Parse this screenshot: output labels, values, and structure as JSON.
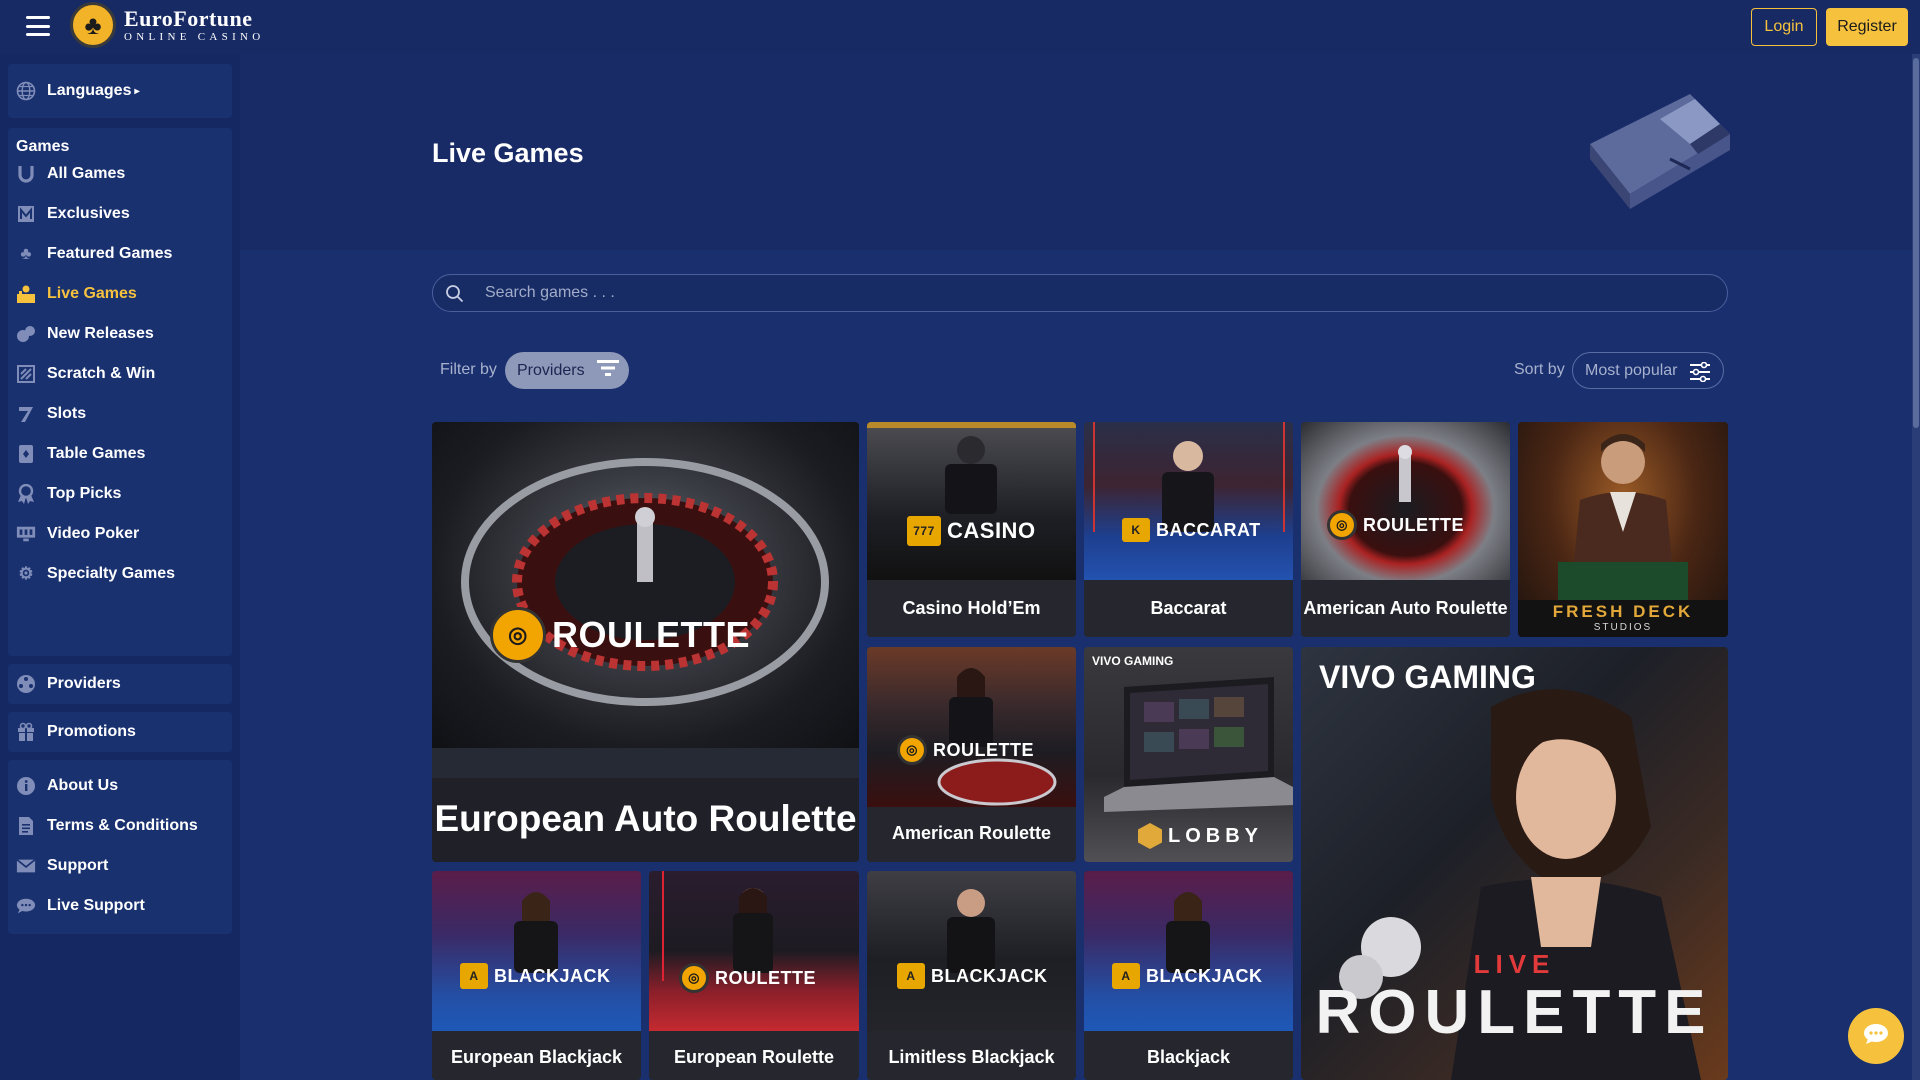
{
  "header": {
    "logo_main": "EuroFortune",
    "logo_sub": "ONLINE CASINO",
    "login_label": "Login",
    "register_label": "Register"
  },
  "sidebar": {
    "languages_label": "Languages",
    "games_heading": "Games",
    "games": [
      {
        "label": "All Games",
        "icon": "horseshoe-icon"
      },
      {
        "label": "Exclusives",
        "icon": "exclusive-icon"
      },
      {
        "label": "Featured Games",
        "icon": "clover-icon"
      },
      {
        "label": "Live Games",
        "icon": "live-dealer-icon"
      },
      {
        "label": "New Releases",
        "icon": "new-icon"
      },
      {
        "label": "Scratch & Win",
        "icon": "scratch-icon"
      },
      {
        "label": "Slots",
        "icon": "slot-seven-icon"
      },
      {
        "label": "Table Games",
        "icon": "card-icon"
      },
      {
        "label": "Top Picks",
        "icon": "award-icon"
      },
      {
        "label": "Video Poker",
        "icon": "monitor-icon"
      },
      {
        "label": "Specialty Games",
        "icon": "gear-icon"
      }
    ],
    "providers_label": "Providers",
    "promotions_label": "Promotions",
    "info": [
      {
        "label": "About Us",
        "icon": "info-icon"
      },
      {
        "label": "Terms & Conditions",
        "icon": "document-icon"
      },
      {
        "label": "Support",
        "icon": "mail-icon"
      },
      {
        "label": "Live Support",
        "icon": "chat-icon"
      }
    ],
    "active_item": "Live Games"
  },
  "main": {
    "title": "Live Games",
    "search_placeholder": "Search games . . .",
    "filter_label": "Filter by",
    "providers_button": "Providers",
    "sort_label": "Sort by",
    "sort_value": "Most popular"
  },
  "tiles": [
    {
      "name": "European Auto Roulette",
      "brand": "ROULETTE"
    },
    {
      "name": "Casino Hold’Em",
      "brand": "CASINO"
    },
    {
      "name": "Baccarat",
      "brand": "BACCARAT"
    },
    {
      "name": "American Auto Roulette",
      "brand": "ROULETTE"
    },
    {
      "name": "",
      "brand": "FRESH DECK",
      "brand_sub": "STUDIOS"
    },
    {
      "name": "American Roulette",
      "brand": "ROULETTE"
    },
    {
      "name": "",
      "brand": "LOBBY",
      "provider": "VIVO GAMING"
    },
    {
      "name": "",
      "brand": "ROULETTE",
      "brand_top": "LIVE",
      "provider": "VIVO GAMING"
    },
    {
      "name": "European Blackjack",
      "brand": "BLACKJACK"
    },
    {
      "name": "European Roulette",
      "brand": "ROULETTE"
    },
    {
      "name": "Limitless Blackjack",
      "brand": "BLACKJACK"
    },
    {
      "name": "Blackjack",
      "brand": "BLACKJACK"
    }
  ],
  "colors": {
    "accent": "#f6c23e",
    "background": "#1a2f6e",
    "header": "#172a64",
    "sidebar": "#152861"
  }
}
